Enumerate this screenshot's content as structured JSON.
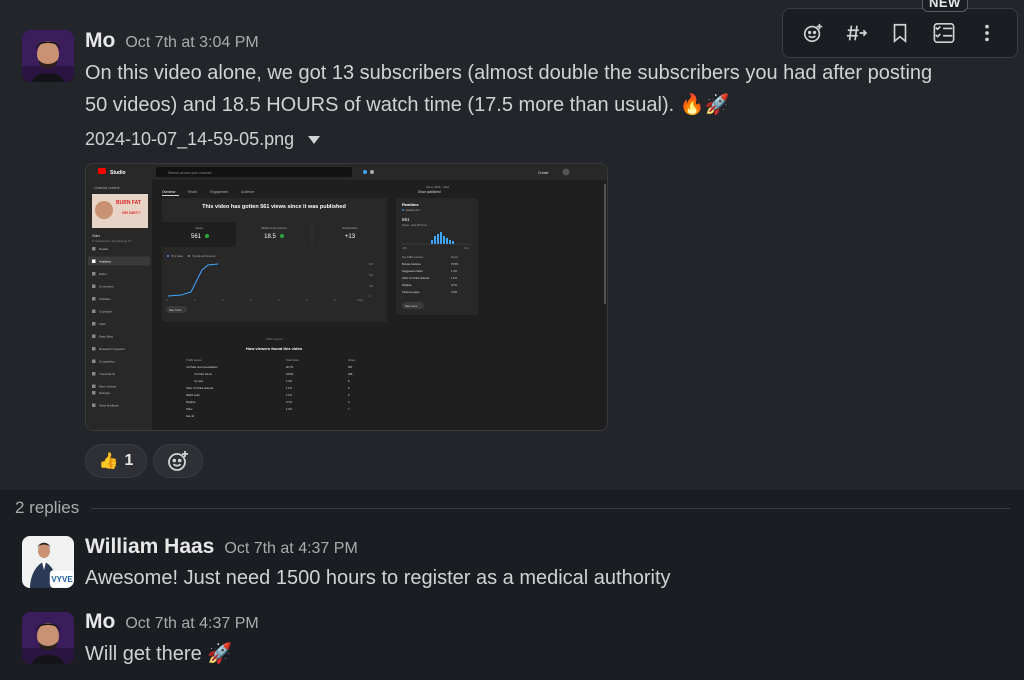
{
  "toolbar": {
    "new_badge": "NEW",
    "actions": [
      "add-reaction",
      "forward",
      "save",
      "add-to-list",
      "more"
    ]
  },
  "messages": [
    {
      "author": "Mo",
      "time": "Oct 7th at 3:04 PM",
      "text_line1": "On this video alone, we got 13 subscribers (almost double the subscribers you had after posting",
      "text_line2": "50 videos) and 18.5 HOURS of watch time (17.5 more than usual). 🔥🚀",
      "attachment": {
        "filename": "2024-10-07_14-59-05.png"
      },
      "reactions": [
        {
          "emoji": "👍",
          "count": "1"
        }
      ]
    }
  ],
  "thread": {
    "replies_label": "2 replies",
    "replies": [
      {
        "author": "William Haas",
        "time": "Oct 7th at 4:37 PM",
        "text": "Awesome! Just need 1500 hours to register as a medical authority",
        "avatar_badge": "VYVE"
      },
      {
        "author": "Mo",
        "time": "Oct 7th at 4:37 PM",
        "text": "Will get there 🚀"
      }
    ]
  },
  "screenshot": {
    "app_name": "Studio",
    "search_placeholder": "Search across your channel",
    "create_label": "Create",
    "sidebar_header": "Channel content",
    "thumb_text1": "BURN FAT",
    "thumb_text2": "OR DIET?",
    "video_label": "Video",
    "video_sub": "Is Yeast Explore: Good Energy (?)",
    "nav": [
      "Details",
      "Analytics",
      "Editor",
      "Comments",
      "Subtitles",
      "Copyright",
      "Clips",
      "Early Beta",
      "Research Inspector",
      "Competition",
      "Trend Alerts",
      "Most Viewed",
      "Settings",
      "Send feedback"
    ],
    "tabs": [
      "Overview",
      "Reach",
      "Engagement",
      "Audience"
    ],
    "headline": "This video has gotten 561 views since it was published",
    "stats": [
      {
        "label": "Views",
        "value": "561"
      },
      {
        "label": "Watch time (hours)",
        "value": "18.5"
      },
      {
        "label": "Subscribers",
        "value": "+13"
      }
    ],
    "legend": [
      "This video",
      "Typical performance"
    ],
    "see_more": "See more",
    "date_range_top": "Oct 2, 2024 – Now",
    "date_range": "Since published",
    "realtime_title": "Realtime",
    "realtime_sub": "Updating live",
    "realtime_value": "561",
    "realtime_caption": "Views · Last 48 hours",
    "realtime_axis": [
      "-48h",
      "Now"
    ],
    "sources_header": [
      "Top traffic sources",
      "Views"
    ],
    "sources": [
      {
        "name": "Browse features",
        "pct": "70.5%"
      },
      {
        "name": "Suggested videos",
        "pct": "1.4%"
      },
      {
        "name": "Other YouTube features",
        "pct": "1.1%"
      },
      {
        "name": "Playlists",
        "pct": "0.7%"
      },
      {
        "name": "Channel pages",
        "pct": "0.4%"
      }
    ],
    "traffic_header_small": "Traffic sources",
    "traffic_title": "How viewers found this video",
    "traffic_cols": [
      "Traffic source",
      "Total views",
      "Views"
    ],
    "traffic_rows": [
      {
        "name": "YouTube recommendations",
        "pct": "90.7%",
        "n": "501"
      },
      {
        "name": "YouTube Home",
        "pct": "54.9%",
        "n": "308"
      },
      {
        "name": "Up next",
        "pct": "1.4%",
        "n": "8"
      },
      {
        "name": "Other YouTube features",
        "pct": "1.1%",
        "n": "6"
      },
      {
        "name": "Watch Later",
        "pct": "1.1%",
        "n": "6"
      },
      {
        "name": "Playlists",
        "pct": "0.7%",
        "n": "4"
      },
      {
        "name": "Other",
        "pct": "1.2%",
        "n": "7"
      },
      {
        "name": "See all",
        "pct": "",
        "n": ""
      }
    ],
    "y_ticks": [
      "600",
      "400",
      "200",
      "0"
    ],
    "x_ticks": [
      "0",
      "1",
      "2",
      "3",
      "4",
      "5",
      "6",
      "7 days"
    ]
  },
  "colors": {
    "background": "#1a1d21",
    "message_hover": "#222529",
    "text": "#d1d2d3",
    "muted": "#ababad",
    "accent_blue": "#1d9bd1"
  }
}
